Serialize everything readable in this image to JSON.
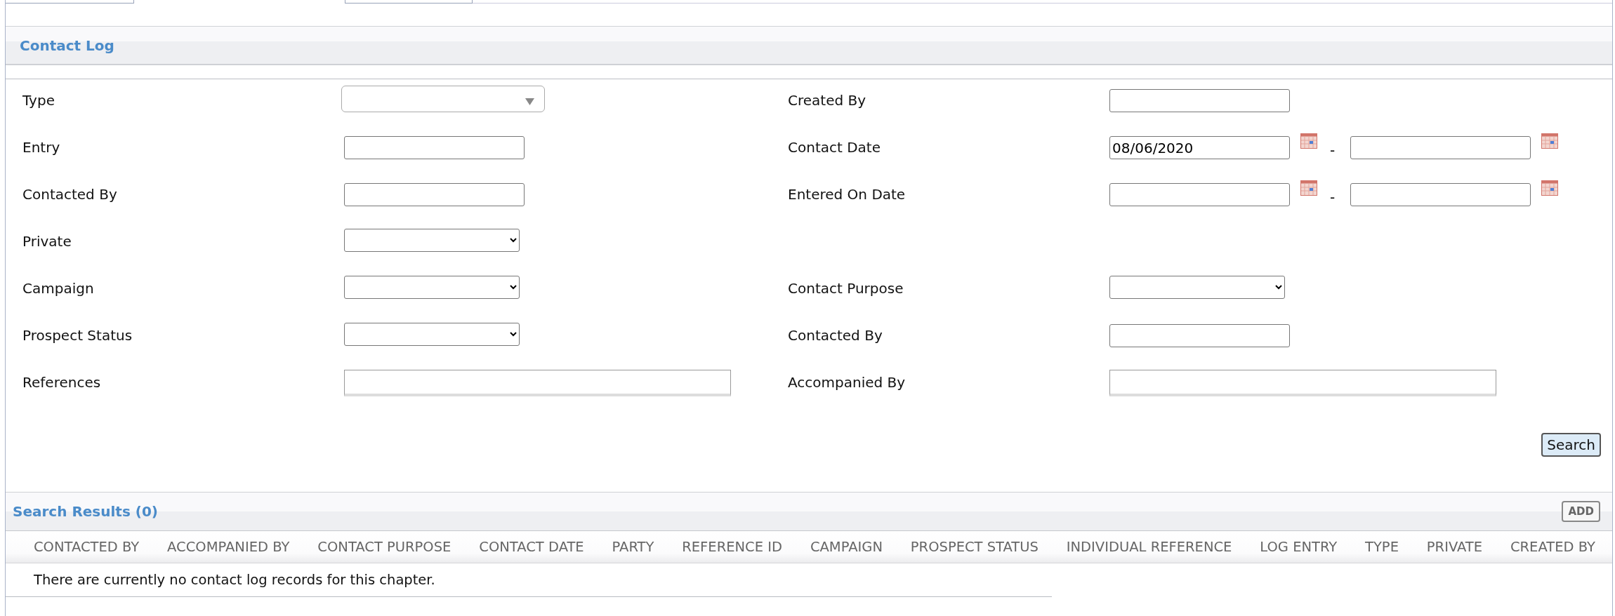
{
  "header": {
    "title": "Contact Log"
  },
  "form": {
    "rows": [
      {
        "left": {
          "label": "Type",
          "kind": "combo"
        },
        "right": {
          "label": "Created By",
          "kind": "text"
        }
      },
      {
        "left": {
          "label": "Entry",
          "kind": "text"
        },
        "right": {
          "label": "Contact Date",
          "kind": "daterange",
          "from_value": "08/06/2020",
          "separator": "-"
        }
      },
      {
        "left": {
          "label": "Contacted By",
          "kind": "text"
        },
        "right": {
          "label": "Entered On Date",
          "kind": "daterange",
          "separator": "-"
        }
      },
      {
        "left": {
          "label": "Private",
          "kind": "select"
        }
      },
      {
        "left": {
          "label": "Campaign",
          "kind": "select"
        },
        "right": {
          "label": "Contact Purpose",
          "kind": "select"
        }
      },
      {
        "left": {
          "label": "Prospect Status",
          "kind": "select"
        },
        "right": {
          "label": "Contacted By",
          "kind": "text"
        }
      },
      {
        "left": {
          "label": "References",
          "kind": "wide"
        },
        "right": {
          "label": "Accompanied By",
          "kind": "wide"
        }
      }
    ],
    "search_button": "Search"
  },
  "results": {
    "title": "Search Results (0)",
    "add_button": "ADD",
    "columns": [
      "CONTACTED BY",
      "ACCOMPANIED BY",
      "CONTACT PURPOSE",
      "CONTACT DATE",
      "PARTY",
      "REFERENCE ID",
      "CAMPAIGN",
      "PROSPECT STATUS",
      "INDIVIDUAL REFERENCE",
      "LOG ENTRY",
      "TYPE",
      "PRIVATE",
      "CREATED BY"
    ],
    "empty_message": "There are currently no contact log records for this chapter."
  }
}
